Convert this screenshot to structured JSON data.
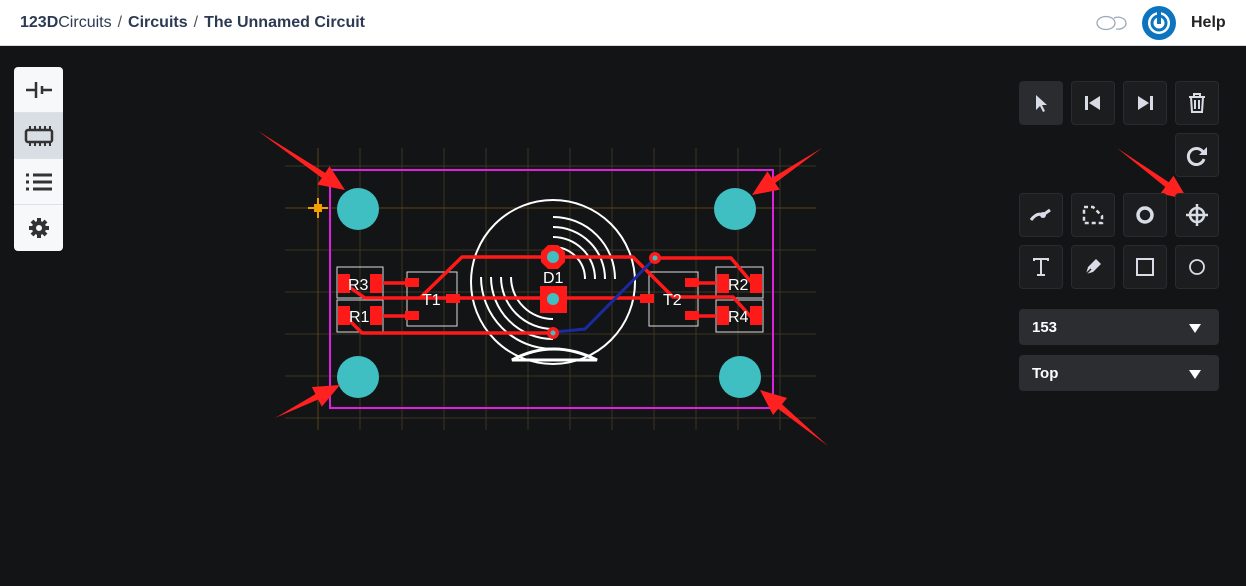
{
  "header": {
    "brand_bold": "123D",
    "brand": "Circuits",
    "breadcrumb": [
      "Circuits",
      "The Unnamed Circuit"
    ],
    "help": "Help"
  },
  "left_panel": {
    "items": [
      "battery-icon",
      "chip-icon",
      "list-icon",
      "gear-icon"
    ],
    "selected": 1
  },
  "toolbar": {
    "buttons": [
      "select",
      "step-back",
      "step-forward",
      "delete",
      "rotate",
      "trace",
      "polygon",
      "via",
      "hole",
      "text",
      "pen",
      "rectangle",
      "circle"
    ],
    "selected": "select"
  },
  "dropdowns": {
    "width_value": "153",
    "layer_value": "Top"
  },
  "pcb": {
    "labels": {
      "r1": "R1",
      "r2": "R2",
      "r3": "R3",
      "r4": "R4",
      "t1": "T1",
      "t2": "T2",
      "d1": "D1"
    },
    "colors": {
      "trace": "#ff1a1a",
      "hole": "#3fbfc2",
      "outline": "#e020e0",
      "silk": "#ffffff",
      "bottom_trace": "#1a2aa0",
      "arrow": "#ff2020"
    }
  }
}
